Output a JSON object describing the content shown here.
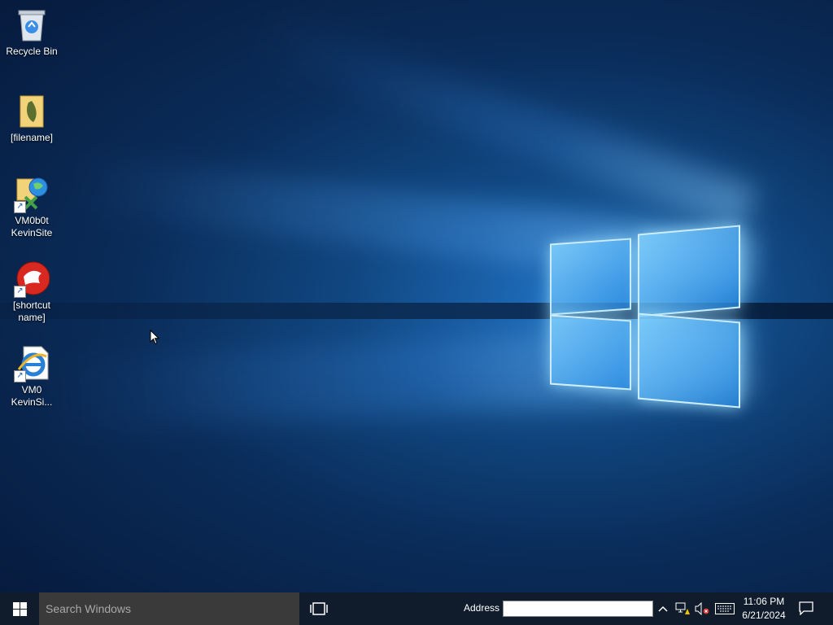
{
  "desktop": {
    "icons": [
      {
        "name": "recycle-bin",
        "label": "Recycle Bin"
      },
      {
        "name": "folder",
        "label": "[filename]"
      },
      {
        "name": "website-shortcut",
        "label": "VM0b0t KevinSite"
      },
      {
        "name": "app-shortcut",
        "label": "[shortcut name]"
      },
      {
        "name": "ie-shortcut",
        "label": "VM0 KevinSi..."
      }
    ]
  },
  "taskbar": {
    "search_placeholder": "Search Windows",
    "address_label": "Address",
    "address_value": "",
    "clock": {
      "time": "11:06 PM",
      "date": "6/21/2024"
    }
  },
  "icons": {
    "start": "windows-logo-icon",
    "task_view": "task-view-icon",
    "tray_expand": "chevron-up-icon",
    "network": "network-warning-icon",
    "volume": "volume-muted-icon",
    "keyboard": "touch-keyboard-icon",
    "notifications": "action-center-icon"
  },
  "colors": {
    "taskbar": "#101c2c",
    "search_box": "#3a3a3a",
    "accent": "#1f6fc0"
  }
}
